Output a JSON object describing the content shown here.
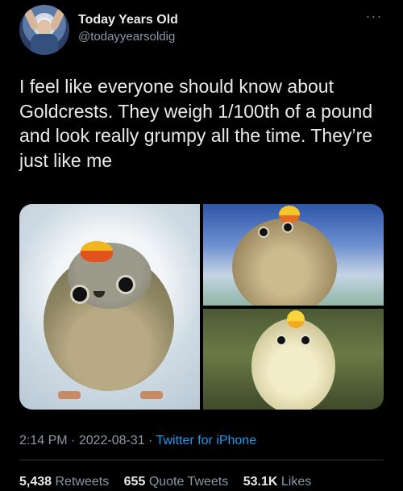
{
  "author": {
    "name": "Today Years Old",
    "handle": "@todayyearsoldig"
  },
  "tweet": {
    "text": "I feel like everyone should know about Goldcrests. They weigh 1/100th of a pound and look really grumpy all the time. They’re just like me"
  },
  "meta": {
    "time": "2:14 PM",
    "separator1": " · ",
    "date": "2022-08-31",
    "separator2": " · ",
    "source": "Twitter for iPhone"
  },
  "stats": {
    "retweets_count": "5,438",
    "retweets_label": "Retweets",
    "quotes_count": "655",
    "quotes_label": "Quote Tweets",
    "likes_count": "53.1K",
    "likes_label": "Likes"
  },
  "icons": {
    "more": "more-icon"
  },
  "colors": {
    "background": "#000000",
    "text": "#e7e9ea",
    "muted": "#8b98a5",
    "link": "#1d9bf0"
  }
}
